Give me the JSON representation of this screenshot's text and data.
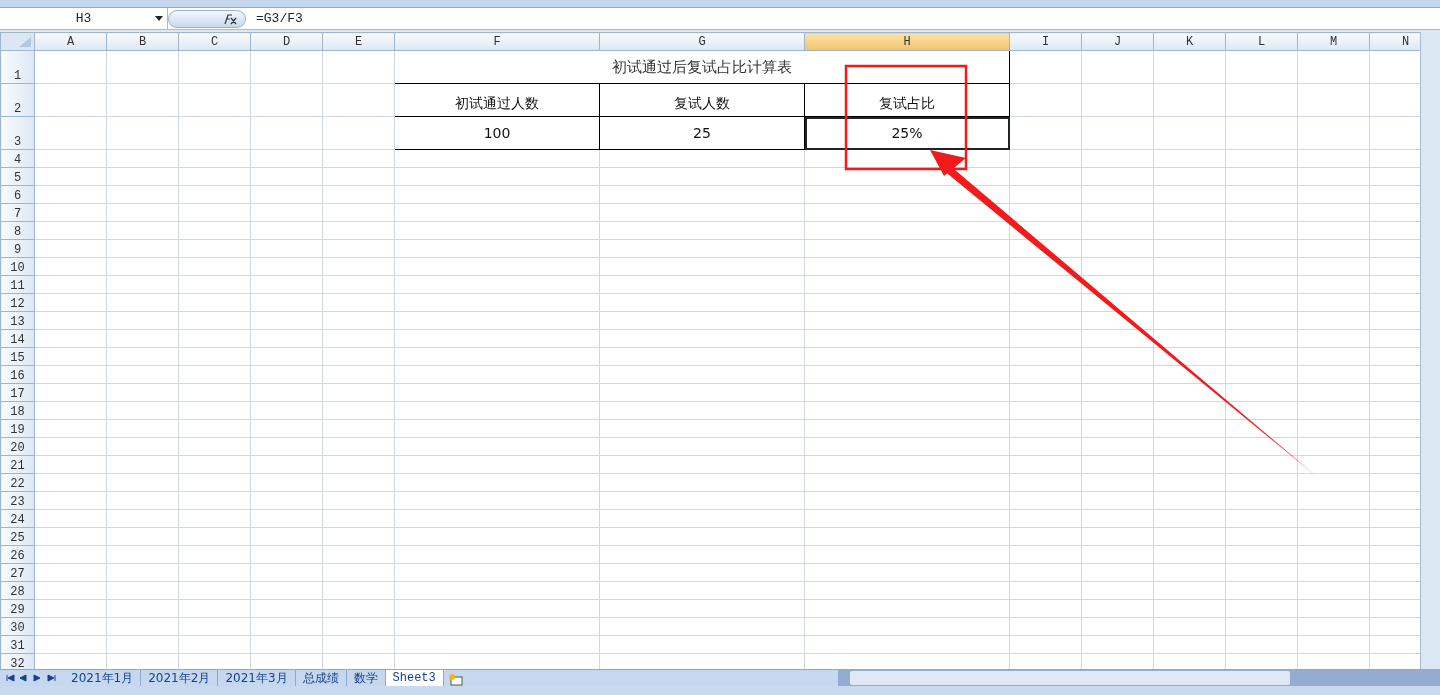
{
  "formula_bar": {
    "name_box": "H3",
    "formula": "=G3/F3"
  },
  "columns": [
    {
      "label": "A",
      "selected": false
    },
    {
      "label": "B",
      "selected": false
    },
    {
      "label": "C",
      "selected": false
    },
    {
      "label": "D",
      "selected": false
    },
    {
      "label": "E",
      "selected": false
    },
    {
      "label": "F",
      "selected": false
    },
    {
      "label": "G",
      "selected": false
    },
    {
      "label": "H",
      "selected": true
    },
    {
      "label": "I",
      "selected": false
    },
    {
      "label": "J",
      "selected": false
    },
    {
      "label": "K",
      "selected": false
    },
    {
      "label": "L",
      "selected": false
    },
    {
      "label": "M",
      "selected": false
    },
    {
      "label": "N",
      "selected": false
    }
  ],
  "rows": [
    "1",
    "2",
    "3",
    "4",
    "5",
    "6",
    "7",
    "8",
    "9",
    "10",
    "11",
    "12",
    "13",
    "14",
    "15",
    "16",
    "17",
    "18",
    "19",
    "20",
    "21",
    "22",
    "23",
    "24",
    "25",
    "26",
    "27",
    "28",
    "29",
    "30",
    "31",
    "32"
  ],
  "table": {
    "title": "初试通过后复试占比计算表",
    "headers": [
      "初试通过人数",
      "复试人数",
      "复试占比"
    ],
    "values": [
      {
        "text": "100",
        "selected": false
      },
      {
        "text": "25",
        "selected": false
      },
      {
        "text": "25%",
        "selected": true
      }
    ]
  },
  "sheet_tabs": [
    {
      "label": "2021年1月",
      "selected": false
    },
    {
      "label": "2021年2月",
      "selected": false
    },
    {
      "label": "2021年3月",
      "selected": false
    },
    {
      "label": "总成绩",
      "selected": false
    },
    {
      "label": "数学",
      "selected": false
    },
    {
      "label": "Sheet3",
      "selected": true
    }
  ]
}
